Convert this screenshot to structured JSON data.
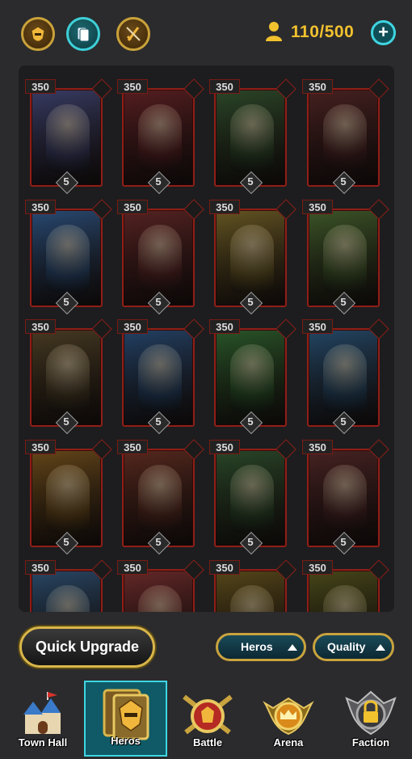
{
  "header": {
    "icons": [
      "helmet-icon",
      "cards-icon",
      "no-sword-icon"
    ],
    "population": "110/500",
    "add_label": "+"
  },
  "heroes": {
    "rows": [
      [
        {
          "power": "350",
          "stars": "5",
          "faction": "sword-faction-icon",
          "tint": "#3a3f6a"
        },
        {
          "power": "350",
          "stars": "5",
          "faction": "sword-faction-icon",
          "tint": "#5a1f22"
        },
        {
          "power": "350",
          "stars": "5",
          "faction": "sword-faction-icon",
          "tint": "#2d4a2a"
        },
        {
          "power": "350",
          "stars": "5",
          "faction": "sword-faction-icon",
          "tint": "#4a2222"
        }
      ],
      [
        {
          "power": "350",
          "stars": "5",
          "faction": "trident-faction-icon",
          "tint": "#2a4e7a"
        },
        {
          "power": "350",
          "stars": "5",
          "faction": "trident-faction-icon",
          "tint": "#5a2424"
        },
        {
          "power": "350",
          "stars": "5",
          "faction": "leaf-faction-icon",
          "tint": "#6a5a24"
        },
        {
          "power": "350",
          "stars": "5",
          "faction": "leaf-faction-icon",
          "tint": "#3f5a2a"
        }
      ],
      [
        {
          "power": "350",
          "stars": "5",
          "faction": "shield-faction-icon",
          "tint": "#4a3d24"
        },
        {
          "power": "350",
          "stars": "5",
          "faction": "shield-faction-icon",
          "tint": "#24446a"
        },
        {
          "power": "350",
          "stars": "5",
          "faction": "shield-faction-icon",
          "tint": "#2a5a2a"
        },
        {
          "power": "350",
          "stars": "5",
          "faction": "shield-faction-icon",
          "tint": "#244a6a"
        }
      ],
      [
        {
          "power": "350",
          "stars": "5",
          "faction": "sword-faction-icon",
          "tint": "#6a4a1a"
        },
        {
          "power": "350",
          "stars": "5",
          "faction": "sword-faction-icon",
          "tint": "#5a2a1f"
        },
        {
          "power": "350",
          "stars": "5",
          "faction": "trident-faction-icon",
          "tint": "#2a4a2a"
        },
        {
          "power": "350",
          "stars": "5",
          "faction": "trident-faction-icon",
          "tint": "#4a2424"
        }
      ],
      [
        {
          "power": "350",
          "stars": "",
          "faction": "trident-faction-icon",
          "tint": "#2a4a6a"
        },
        {
          "power": "350",
          "stars": "",
          "faction": "sword-faction-icon",
          "tint": "#6a2a2a"
        },
        {
          "power": "350",
          "stars": "",
          "faction": "leaf-faction-icon",
          "tint": "#5a4a1a"
        },
        {
          "power": "350",
          "stars": "",
          "faction": "shield-faction-icon",
          "tint": "#4a4a1a"
        }
      ]
    ]
  },
  "actions": {
    "quick_upgrade": "Quick Upgrade",
    "heros_sort": "Heros",
    "quality_sort": "Quality"
  },
  "nav": {
    "items": [
      {
        "label": "Town Hall",
        "icon": "castle-icon"
      },
      {
        "label": "Heros",
        "icon": "hero-helmet-icon"
      },
      {
        "label": "Battle",
        "icon": "crossed-swords-icon"
      },
      {
        "label": "Arena",
        "icon": "crown-emblem-icon"
      },
      {
        "label": "Faction",
        "icon": "lock-emblem-icon"
      }
    ],
    "active_index": 1
  },
  "colors": {
    "gold": "#f2c12e",
    "teal": "#3ed6e2",
    "card_border": "#8e1f18"
  }
}
